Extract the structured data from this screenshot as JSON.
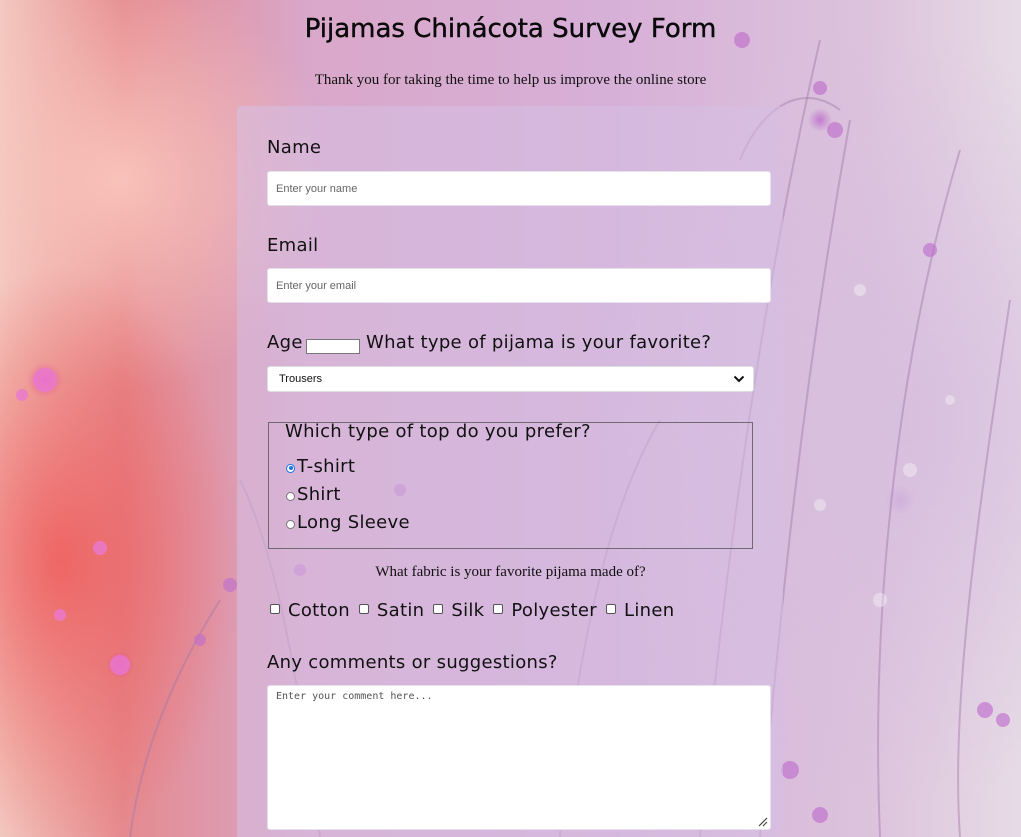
{
  "header": {
    "title": "Pijamas Chinácota Survey Form",
    "subtitle": "Thank you for taking the time to help us improve the online store"
  },
  "form": {
    "name": {
      "label": "Name",
      "placeholder": "Enter your name",
      "value": ""
    },
    "email": {
      "label": "Email",
      "placeholder": "Enter your email",
      "value": ""
    },
    "age": {
      "label": "Age",
      "value": ""
    },
    "pijama_type": {
      "question": "What type of pijama is your favorite?",
      "selected": "Trousers",
      "icon": "chevron-down-icon"
    },
    "top_preference": {
      "legend": "Which type of top do you prefer?",
      "options": [
        {
          "label": "T-shirt",
          "checked": true
        },
        {
          "label": "Shirt",
          "checked": false
        },
        {
          "label": "Long Sleeve",
          "checked": false
        }
      ]
    },
    "fabric": {
      "question": "What fabric is your favorite pijama made of?",
      "options": [
        {
          "label": "Cotton",
          "checked": false
        },
        {
          "label": "Satin",
          "checked": false
        },
        {
          "label": "Silk",
          "checked": false
        },
        {
          "label": "Polyester",
          "checked": false
        },
        {
          "label": "Linen",
          "checked": false
        }
      ]
    },
    "comments": {
      "label": "Any comments or suggestions?",
      "placeholder": "Enter your comment here...",
      "value": "",
      "resize_icon": "resize-handle-icon"
    }
  },
  "colors": {
    "accent": "#1a73e8",
    "card_background": "#d6c0e4",
    "text": "#111111"
  }
}
